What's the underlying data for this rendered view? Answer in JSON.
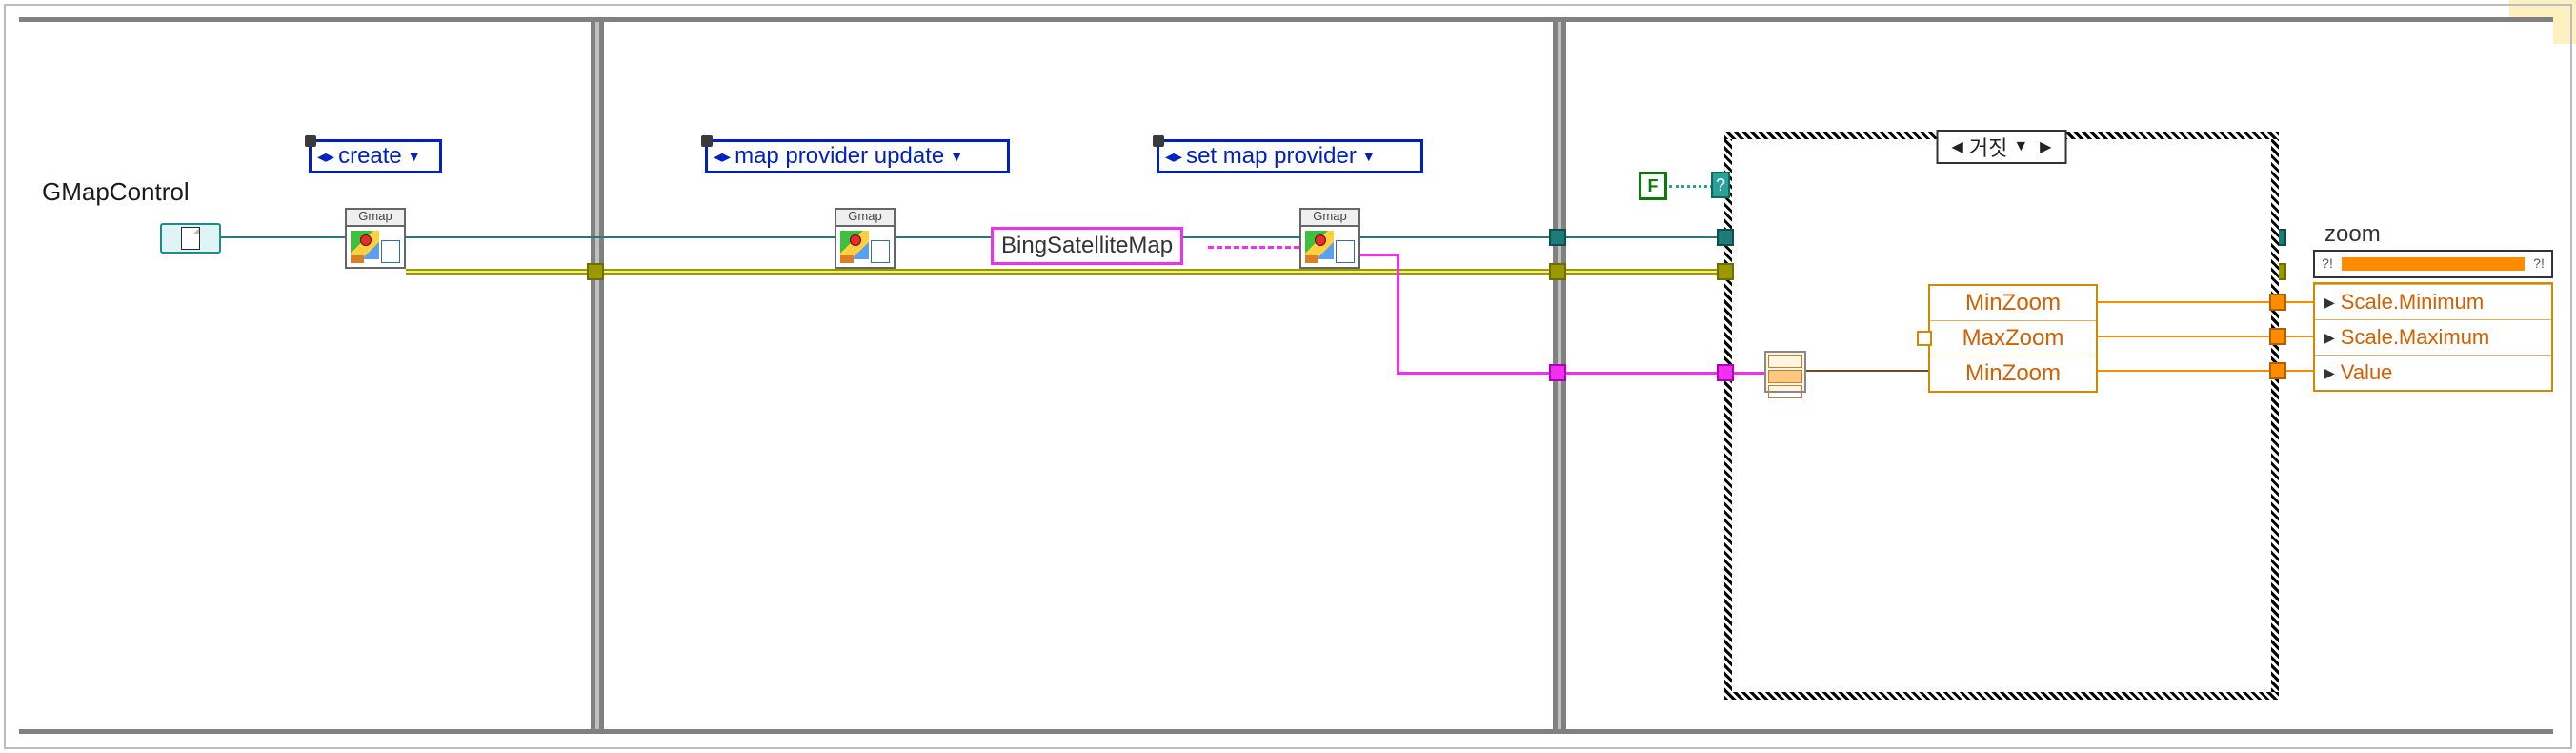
{
  "control": {
    "label": "GMapControl"
  },
  "methods": {
    "m1": "create",
    "m2": "map provider update",
    "m3": "set map provider"
  },
  "subvi": {
    "caption": "Gmap"
  },
  "constants": {
    "provider": "BingSatelliteMap",
    "bool": "F"
  },
  "case": {
    "label": "거짓"
  },
  "unbundle": {
    "items": [
      "MinZoom",
      "MaxZoom",
      "MinZoom"
    ]
  },
  "indicator": {
    "label": "zoom",
    "left_mark": "?!",
    "right_mark": "?!"
  },
  "propnode": {
    "items": [
      "Scale.Minimum",
      "Scale.Maximum",
      "Value"
    ]
  }
}
